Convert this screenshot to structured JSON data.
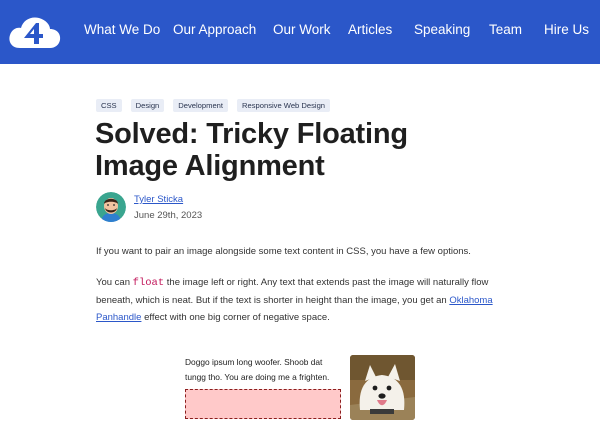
{
  "nav": {
    "items": [
      "What We Do",
      "Our Approach",
      "Our Work",
      "Articles",
      "Speaking",
      "Team",
      "Hire Us"
    ]
  },
  "tags": [
    "CSS",
    "Design",
    "Development",
    "Responsive Web Design"
  ],
  "article": {
    "title_line1": "Solved: Tricky Floating",
    "title_line2": "Image Alignment",
    "author": "Tyler Sticka",
    "date": "June 29th, 2023",
    "p1": "If you want to pair an image alongside some text content in CSS, you have a few options.",
    "p2_before": "You can ",
    "p2_code": "float",
    "p2_after": " the image left or right. Any text that extends past the image will naturally flow beneath, which is neat. But if the text is shorter in height than the image, you get an ",
    "p2_link": "Oklahoma Panhandle",
    "p2_end": " effect with one big corner of negative space."
  },
  "demo": {
    "text": "Doggo ipsum long woofer. Shoob dat tungg tho. You are doing me a frighten."
  },
  "colors": {
    "header": "#2b57c9",
    "tag_bg": "#e9edf6",
    "code": "#c2185b",
    "demo_box": "#ffc9c9"
  }
}
